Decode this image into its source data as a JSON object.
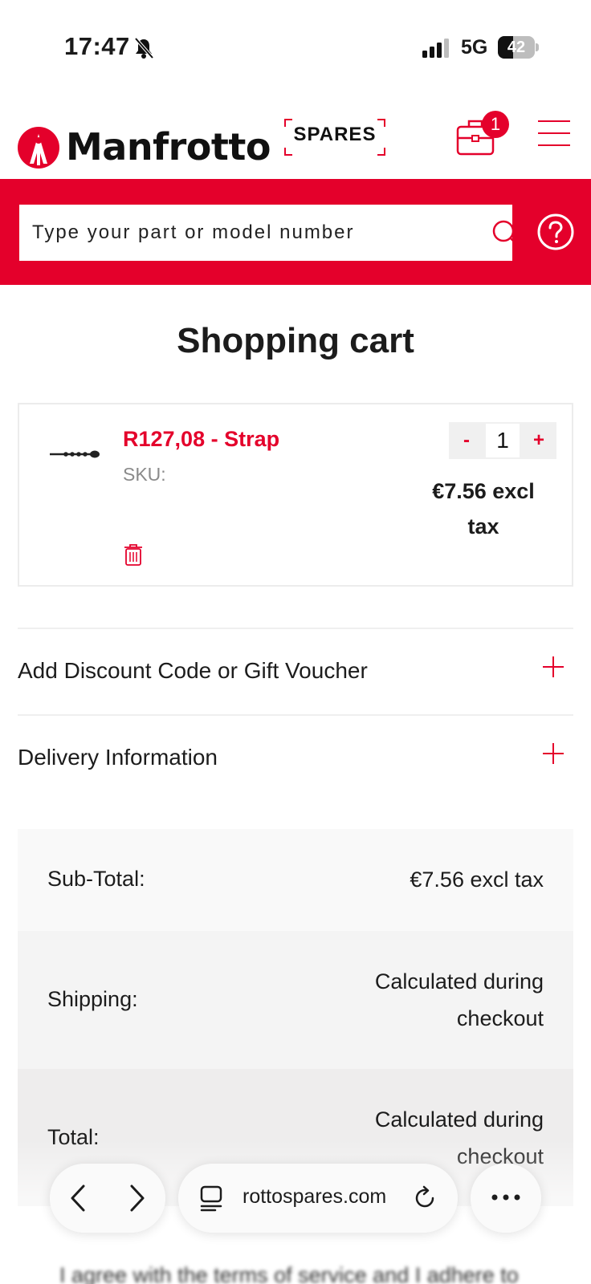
{
  "status_bar": {
    "time": "17:47",
    "network": "5G",
    "battery_percent": "42",
    "battery_level": 0.42
  },
  "header": {
    "logo_text": "Manfrotto",
    "spares_text": "SPARES",
    "cart_count": "1",
    "icons": [
      "tripod-logo-icon",
      "cart-icon",
      "menu-icon",
      "search-icon",
      "help-icon"
    ]
  },
  "search": {
    "placeholder": "Type your part or model number"
  },
  "page": {
    "title": "Shopping cart"
  },
  "cart_items": [
    {
      "name": "R127,08 - Strap",
      "sku_label": "SKU:",
      "quantity": "1",
      "minus_label": "-",
      "plus_label": "+",
      "price_line1": "€7.56 excl",
      "price_line2": "tax"
    }
  ],
  "accordions": [
    {
      "label": "Add Discount Code or Gift Voucher"
    },
    {
      "label": "Delivery Information"
    }
  ],
  "totals": {
    "subtotal_label": "Sub-Total:",
    "subtotal_value": "€7.56 excl tax",
    "shipping_label": "Shipping:",
    "shipping_value_line1": "Calculated during",
    "shipping_value_line2": "checkout",
    "total_label": "Total:",
    "total_value_line1": "Calculated during",
    "total_value_line2": "checkout"
  },
  "terms": {
    "text": "I agree with the terms of service and I adhere to"
  },
  "browser": {
    "url": "rottospares.com"
  },
  "colors": {
    "brand_red": "#e4002b",
    "row_light": "#f9f9f9",
    "row_mid": "#f4f4f4",
    "row_dark": "#eeeded"
  }
}
